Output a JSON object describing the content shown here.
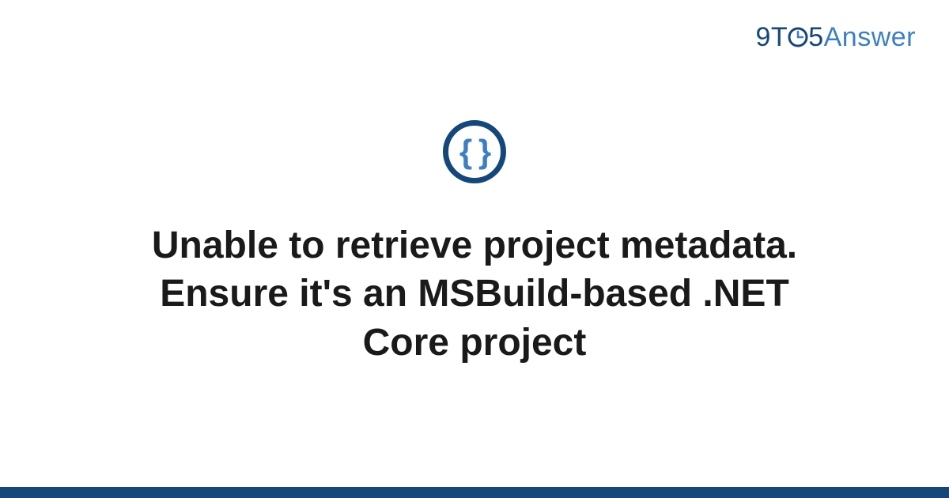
{
  "brand": {
    "part1": "9",
    "part2": "T",
    "part3": "5",
    "part4": "Answer"
  },
  "icon": {
    "name": "braces-icon",
    "glyph": "{ }"
  },
  "title": "Unable to retrieve project metadata. Ensure it's an MSBuild-based .NET Core project",
  "colors": {
    "dark_blue": "#15477a",
    "light_blue": "#3d7fc4"
  }
}
